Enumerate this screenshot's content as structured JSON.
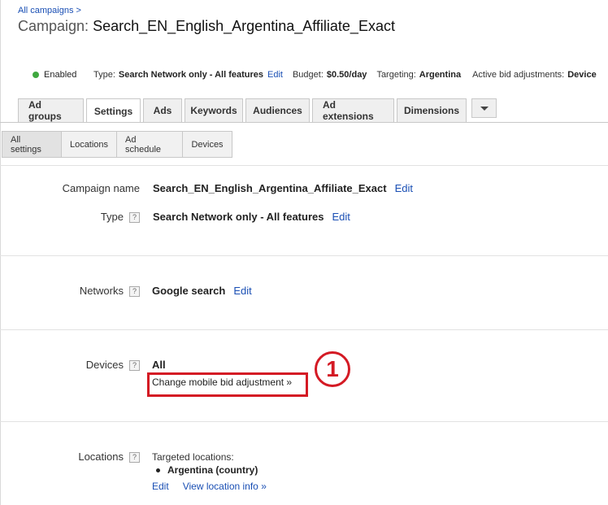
{
  "breadcrumb": {
    "text": "All campaigns >"
  },
  "header": {
    "label": "Campaign:",
    "name": "Search_EN_English_Argentina_Affiliate_Exact"
  },
  "status_bar": {
    "status": "Enabled",
    "status_color": "#3fa83f",
    "type_label": "Type:",
    "type_value": "Search Network only - All features",
    "type_edit": "Edit",
    "budget_label": "Budget:",
    "budget_value": "$0.50/day",
    "targeting_label": "Targeting:",
    "targeting_value": "Argentina",
    "bid_label": "Active bid adjustments:",
    "bid_value": "Device"
  },
  "tabs": [
    {
      "label": "Ad groups"
    },
    {
      "label": "Settings",
      "active": true
    },
    {
      "label": "Ads"
    },
    {
      "label": "Keywords"
    },
    {
      "label": "Audiences"
    },
    {
      "label": "Ad extensions"
    },
    {
      "label": "Dimensions"
    }
  ],
  "subtabs": [
    {
      "label": "All settings",
      "active": true
    },
    {
      "label": "Locations"
    },
    {
      "label": "Ad schedule"
    },
    {
      "label": "Devices"
    }
  ],
  "settings": {
    "help_glyph": "?",
    "campaign_name": {
      "label": "Campaign name",
      "value": "Search_EN_English_Argentina_Affiliate_Exact",
      "edit": "Edit"
    },
    "type": {
      "label": "Type",
      "value": "Search Network only - All features",
      "edit": "Edit"
    },
    "networks": {
      "label": "Networks",
      "value": "Google search",
      "edit": "Edit"
    },
    "devices": {
      "label": "Devices",
      "value": "All",
      "link": "Change mobile bid adjustment »"
    },
    "locations": {
      "label": "Locations",
      "heading": "Targeted locations:",
      "items": [
        "Argentina (country)"
      ],
      "edit": "Edit",
      "view_link": "View location info »"
    }
  },
  "annotation": {
    "number": "1",
    "color": "#d41a24"
  },
  "colors": {
    "link": "#1a4fb4",
    "accent_red": "#d41a24"
  }
}
